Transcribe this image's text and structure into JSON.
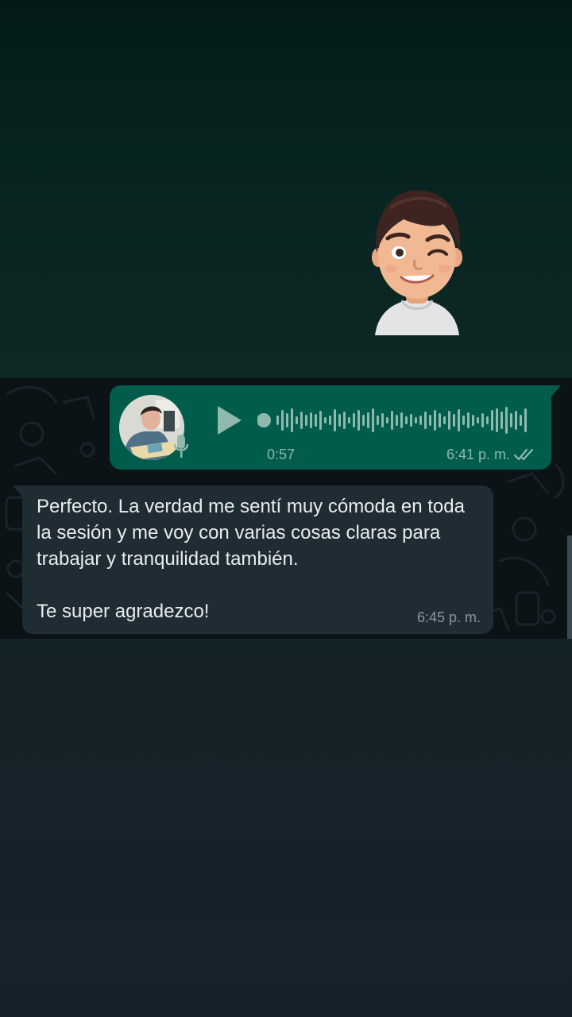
{
  "sticker": {
    "icon": "winking-avatar-sticker-icon"
  },
  "voice_message": {
    "duration": "0:57",
    "time": "6:41 p. m.",
    "status_icon": "double-check-icon",
    "play_icon": "play-icon",
    "mic_icon": "microphone-icon",
    "waveform_icon": "waveform-icon",
    "progress": 0.0
  },
  "text_message": {
    "body": "Perfecto. La verdad me sentí muy cómoda en toda la sesión y me voy con varias cosas claras para trabajar y tranquilidad también.\n\nTe super agradezco!",
    "time": "6:45 p. m."
  },
  "colors": {
    "outgoing_bubble": "#005c4b",
    "incoming_bubble": "#202c33",
    "chat_background": "#0c1317",
    "text_primary": "#e9edef",
    "meta_text": "#8696a0"
  }
}
